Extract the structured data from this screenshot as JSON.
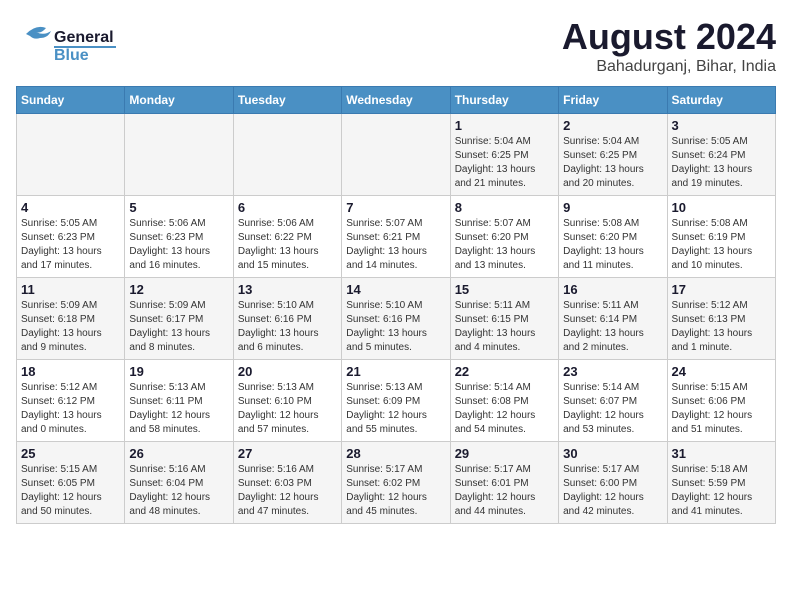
{
  "header": {
    "logo_general": "General",
    "logo_blue": "Blue",
    "main_title": "August 2024",
    "subtitle": "Bahadurganj, Bihar, India"
  },
  "calendar": {
    "days_of_week": [
      "Sunday",
      "Monday",
      "Tuesday",
      "Wednesday",
      "Thursday",
      "Friday",
      "Saturday"
    ],
    "weeks": [
      [
        {
          "day": "",
          "info": ""
        },
        {
          "day": "",
          "info": ""
        },
        {
          "day": "",
          "info": ""
        },
        {
          "day": "",
          "info": ""
        },
        {
          "day": "1",
          "info": "Sunrise: 5:04 AM\nSunset: 6:25 PM\nDaylight: 13 hours and 21 minutes."
        },
        {
          "day": "2",
          "info": "Sunrise: 5:04 AM\nSunset: 6:25 PM\nDaylight: 13 hours and 20 minutes."
        },
        {
          "day": "3",
          "info": "Sunrise: 5:05 AM\nSunset: 6:24 PM\nDaylight: 13 hours and 19 minutes."
        }
      ],
      [
        {
          "day": "4",
          "info": "Sunrise: 5:05 AM\nSunset: 6:23 PM\nDaylight: 13 hours and 17 minutes."
        },
        {
          "day": "5",
          "info": "Sunrise: 5:06 AM\nSunset: 6:23 PM\nDaylight: 13 hours and 16 minutes."
        },
        {
          "day": "6",
          "info": "Sunrise: 5:06 AM\nSunset: 6:22 PM\nDaylight: 13 hours and 15 minutes."
        },
        {
          "day": "7",
          "info": "Sunrise: 5:07 AM\nSunset: 6:21 PM\nDaylight: 13 hours and 14 minutes."
        },
        {
          "day": "8",
          "info": "Sunrise: 5:07 AM\nSunset: 6:20 PM\nDaylight: 13 hours and 13 minutes."
        },
        {
          "day": "9",
          "info": "Sunrise: 5:08 AM\nSunset: 6:20 PM\nDaylight: 13 hours and 11 minutes."
        },
        {
          "day": "10",
          "info": "Sunrise: 5:08 AM\nSunset: 6:19 PM\nDaylight: 13 hours and 10 minutes."
        }
      ],
      [
        {
          "day": "11",
          "info": "Sunrise: 5:09 AM\nSunset: 6:18 PM\nDaylight: 13 hours and 9 minutes."
        },
        {
          "day": "12",
          "info": "Sunrise: 5:09 AM\nSunset: 6:17 PM\nDaylight: 13 hours and 8 minutes."
        },
        {
          "day": "13",
          "info": "Sunrise: 5:10 AM\nSunset: 6:16 PM\nDaylight: 13 hours and 6 minutes."
        },
        {
          "day": "14",
          "info": "Sunrise: 5:10 AM\nSunset: 6:16 PM\nDaylight: 13 hours and 5 minutes."
        },
        {
          "day": "15",
          "info": "Sunrise: 5:11 AM\nSunset: 6:15 PM\nDaylight: 13 hours and 4 minutes."
        },
        {
          "day": "16",
          "info": "Sunrise: 5:11 AM\nSunset: 6:14 PM\nDaylight: 13 hours and 2 minutes."
        },
        {
          "day": "17",
          "info": "Sunrise: 5:12 AM\nSunset: 6:13 PM\nDaylight: 13 hours and 1 minute."
        }
      ],
      [
        {
          "day": "18",
          "info": "Sunrise: 5:12 AM\nSunset: 6:12 PM\nDaylight: 13 hours and 0 minutes."
        },
        {
          "day": "19",
          "info": "Sunrise: 5:13 AM\nSunset: 6:11 PM\nDaylight: 12 hours and 58 minutes."
        },
        {
          "day": "20",
          "info": "Sunrise: 5:13 AM\nSunset: 6:10 PM\nDaylight: 12 hours and 57 minutes."
        },
        {
          "day": "21",
          "info": "Sunrise: 5:13 AM\nSunset: 6:09 PM\nDaylight: 12 hours and 55 minutes."
        },
        {
          "day": "22",
          "info": "Sunrise: 5:14 AM\nSunset: 6:08 PM\nDaylight: 12 hours and 54 minutes."
        },
        {
          "day": "23",
          "info": "Sunrise: 5:14 AM\nSunset: 6:07 PM\nDaylight: 12 hours and 53 minutes."
        },
        {
          "day": "24",
          "info": "Sunrise: 5:15 AM\nSunset: 6:06 PM\nDaylight: 12 hours and 51 minutes."
        }
      ],
      [
        {
          "day": "25",
          "info": "Sunrise: 5:15 AM\nSunset: 6:05 PM\nDaylight: 12 hours and 50 minutes."
        },
        {
          "day": "26",
          "info": "Sunrise: 5:16 AM\nSunset: 6:04 PM\nDaylight: 12 hours and 48 minutes."
        },
        {
          "day": "27",
          "info": "Sunrise: 5:16 AM\nSunset: 6:03 PM\nDaylight: 12 hours and 47 minutes."
        },
        {
          "day": "28",
          "info": "Sunrise: 5:17 AM\nSunset: 6:02 PM\nDaylight: 12 hours and 45 minutes."
        },
        {
          "day": "29",
          "info": "Sunrise: 5:17 AM\nSunset: 6:01 PM\nDaylight: 12 hours and 44 minutes."
        },
        {
          "day": "30",
          "info": "Sunrise: 5:17 AM\nSunset: 6:00 PM\nDaylight: 12 hours and 42 minutes."
        },
        {
          "day": "31",
          "info": "Sunrise: 5:18 AM\nSunset: 5:59 PM\nDaylight: 12 hours and 41 minutes."
        }
      ]
    ]
  }
}
